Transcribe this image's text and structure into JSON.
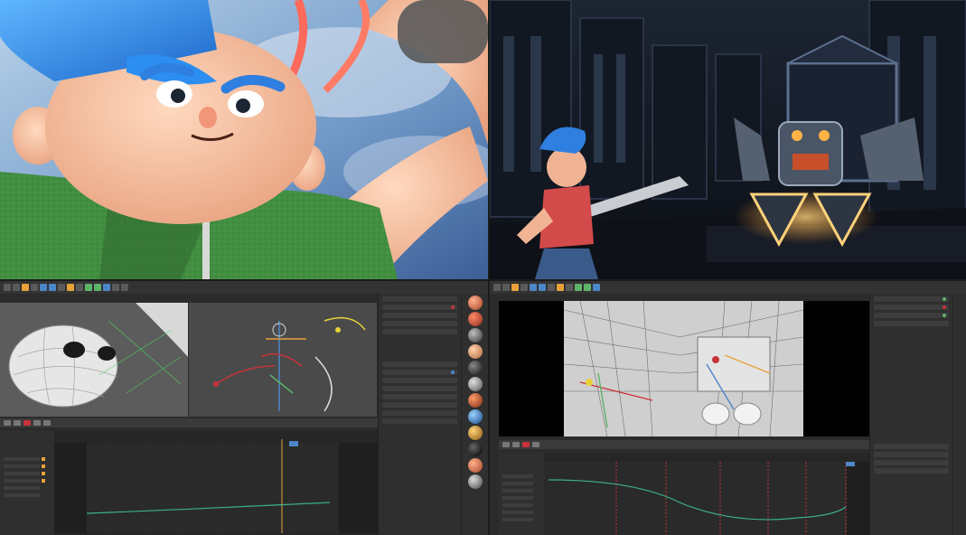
{
  "panels": {
    "top_left": {
      "kind": "render",
      "subject": "cartoon-boy-closeup"
    },
    "top_right": {
      "kind": "render",
      "subject": "hero-vs-robot-throne-room"
    },
    "bottom_left": {
      "kind": "3d-editor",
      "subject": "rigged-character-views"
    },
    "bottom_right": {
      "kind": "3d-editor",
      "subject": "scene-wireframe-view"
    }
  },
  "colors": {
    "editor_bg": "#2b2b2b",
    "accent_orange": "#e8a23a",
    "accent_blue": "#4c86c9",
    "accent_green": "#5db36a",
    "keyframe_red": "#c8323a",
    "fcurve_green": "#3db08a"
  },
  "icons": [
    "play-icon",
    "stop-icon",
    "record-icon",
    "material-sphere-icon"
  ]
}
